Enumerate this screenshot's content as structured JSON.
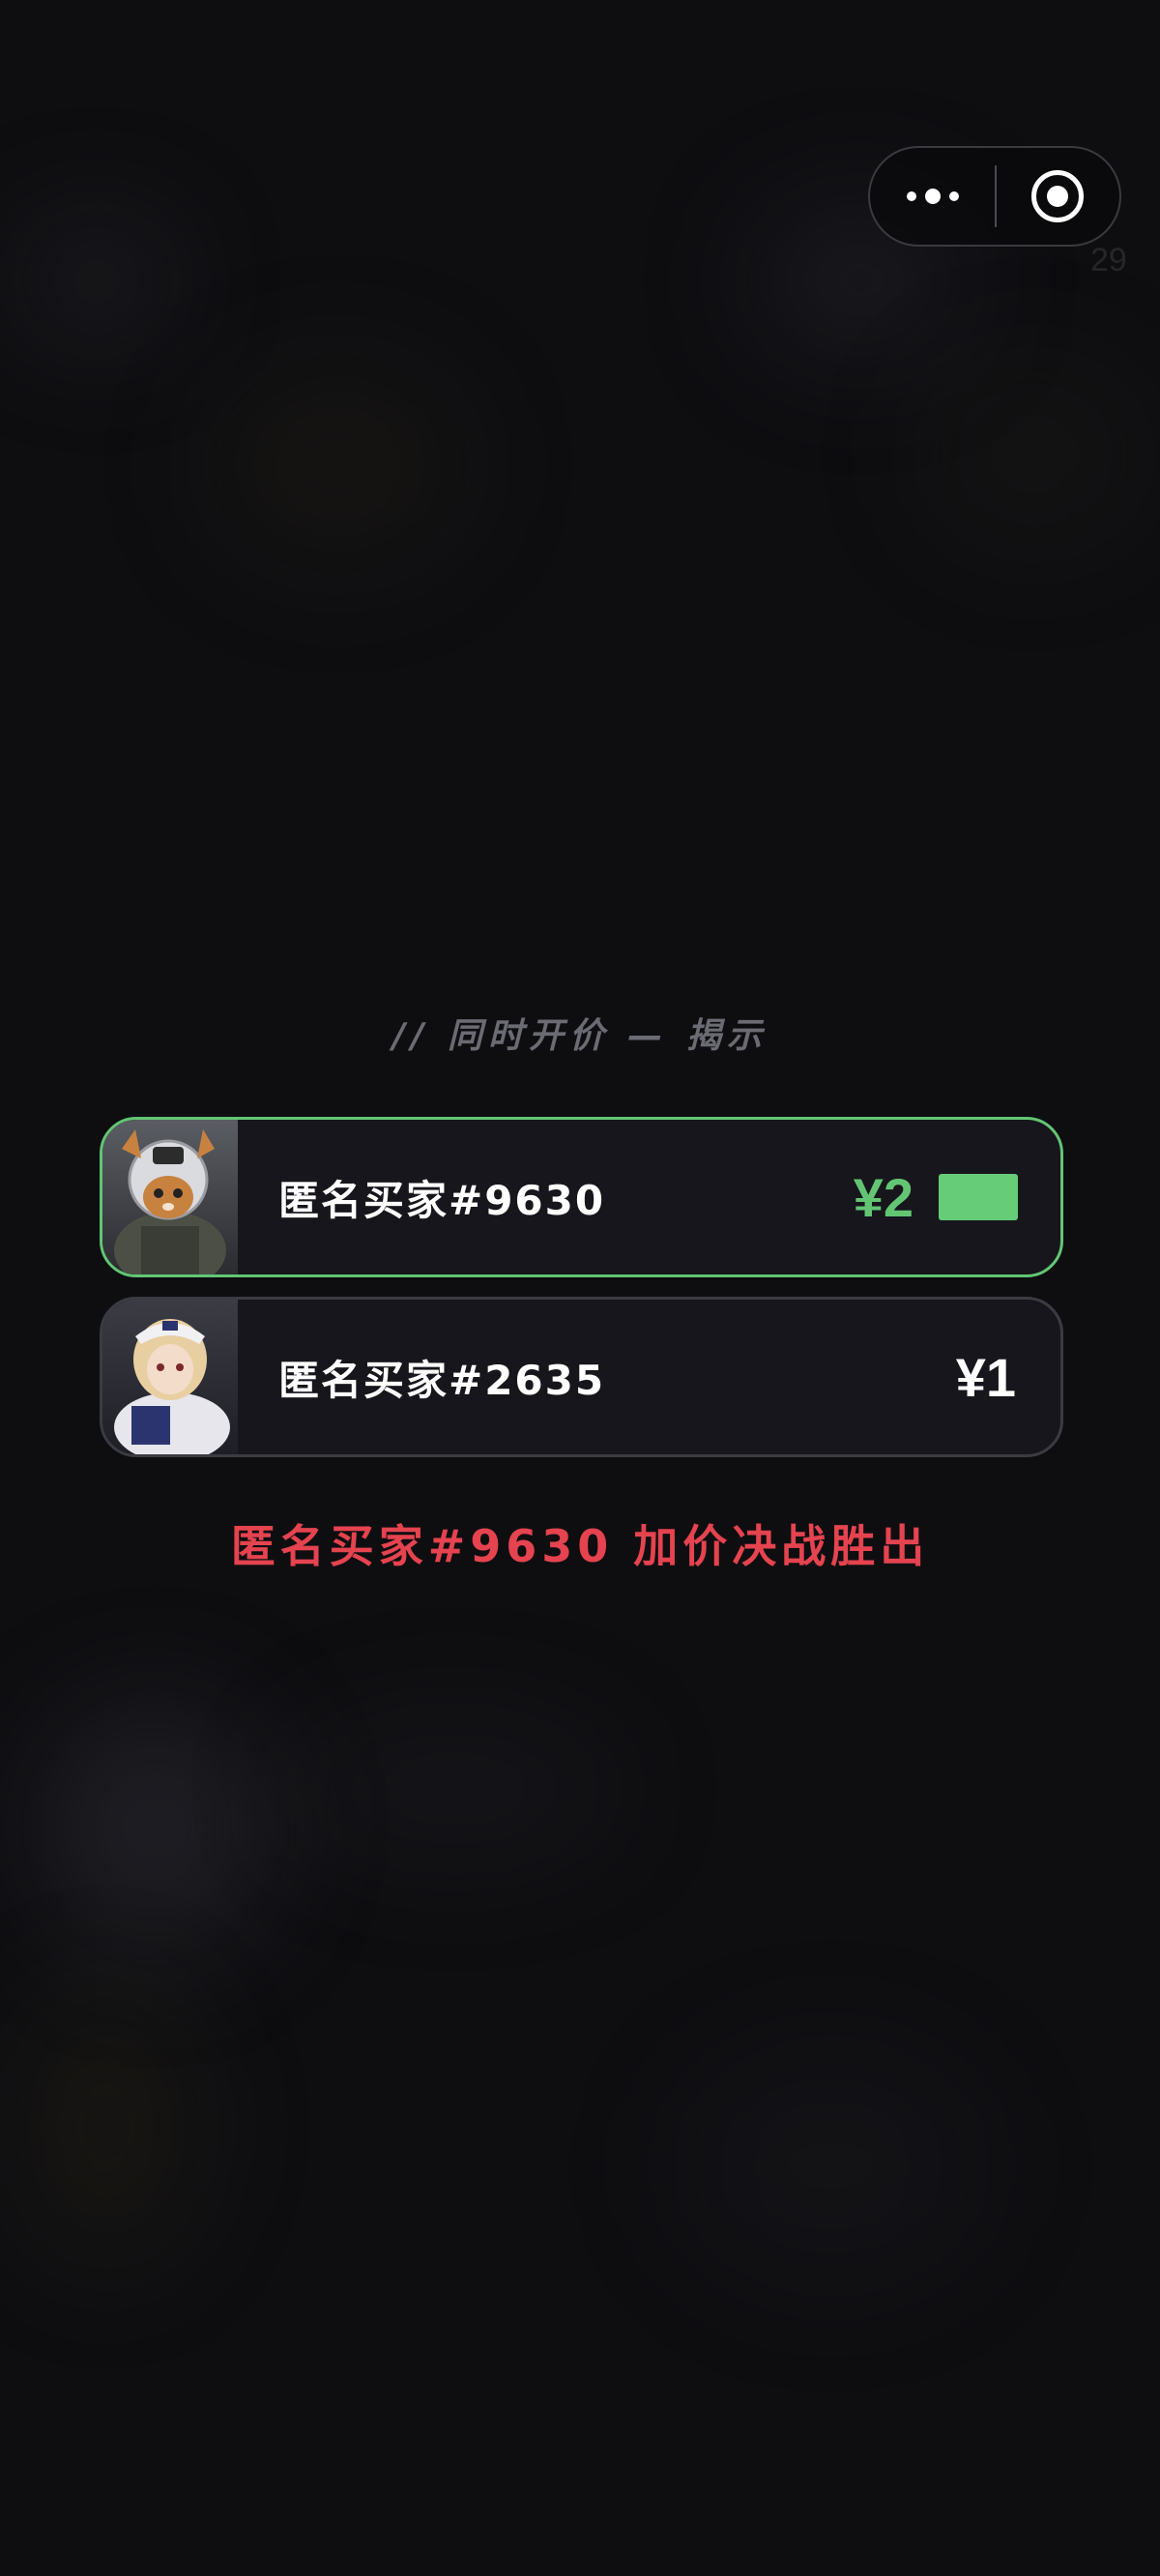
{
  "capsule": {
    "more_icon": "more-dots-icon",
    "close_icon": "target-close-icon"
  },
  "background_number": "29",
  "auction": {
    "section_title": "// 同时开价 — 揭示",
    "bids": [
      {
        "buyer": "匿名买家#9630",
        "price": "¥2",
        "leading": true,
        "accent": "#63c574"
      },
      {
        "buyer": "匿名买家#2635",
        "price": "¥1",
        "leading": false,
        "accent": "#ffffff"
      }
    ],
    "result_text": "匿名买家#9630 加价决战胜出",
    "result_color": "#e4434f"
  }
}
